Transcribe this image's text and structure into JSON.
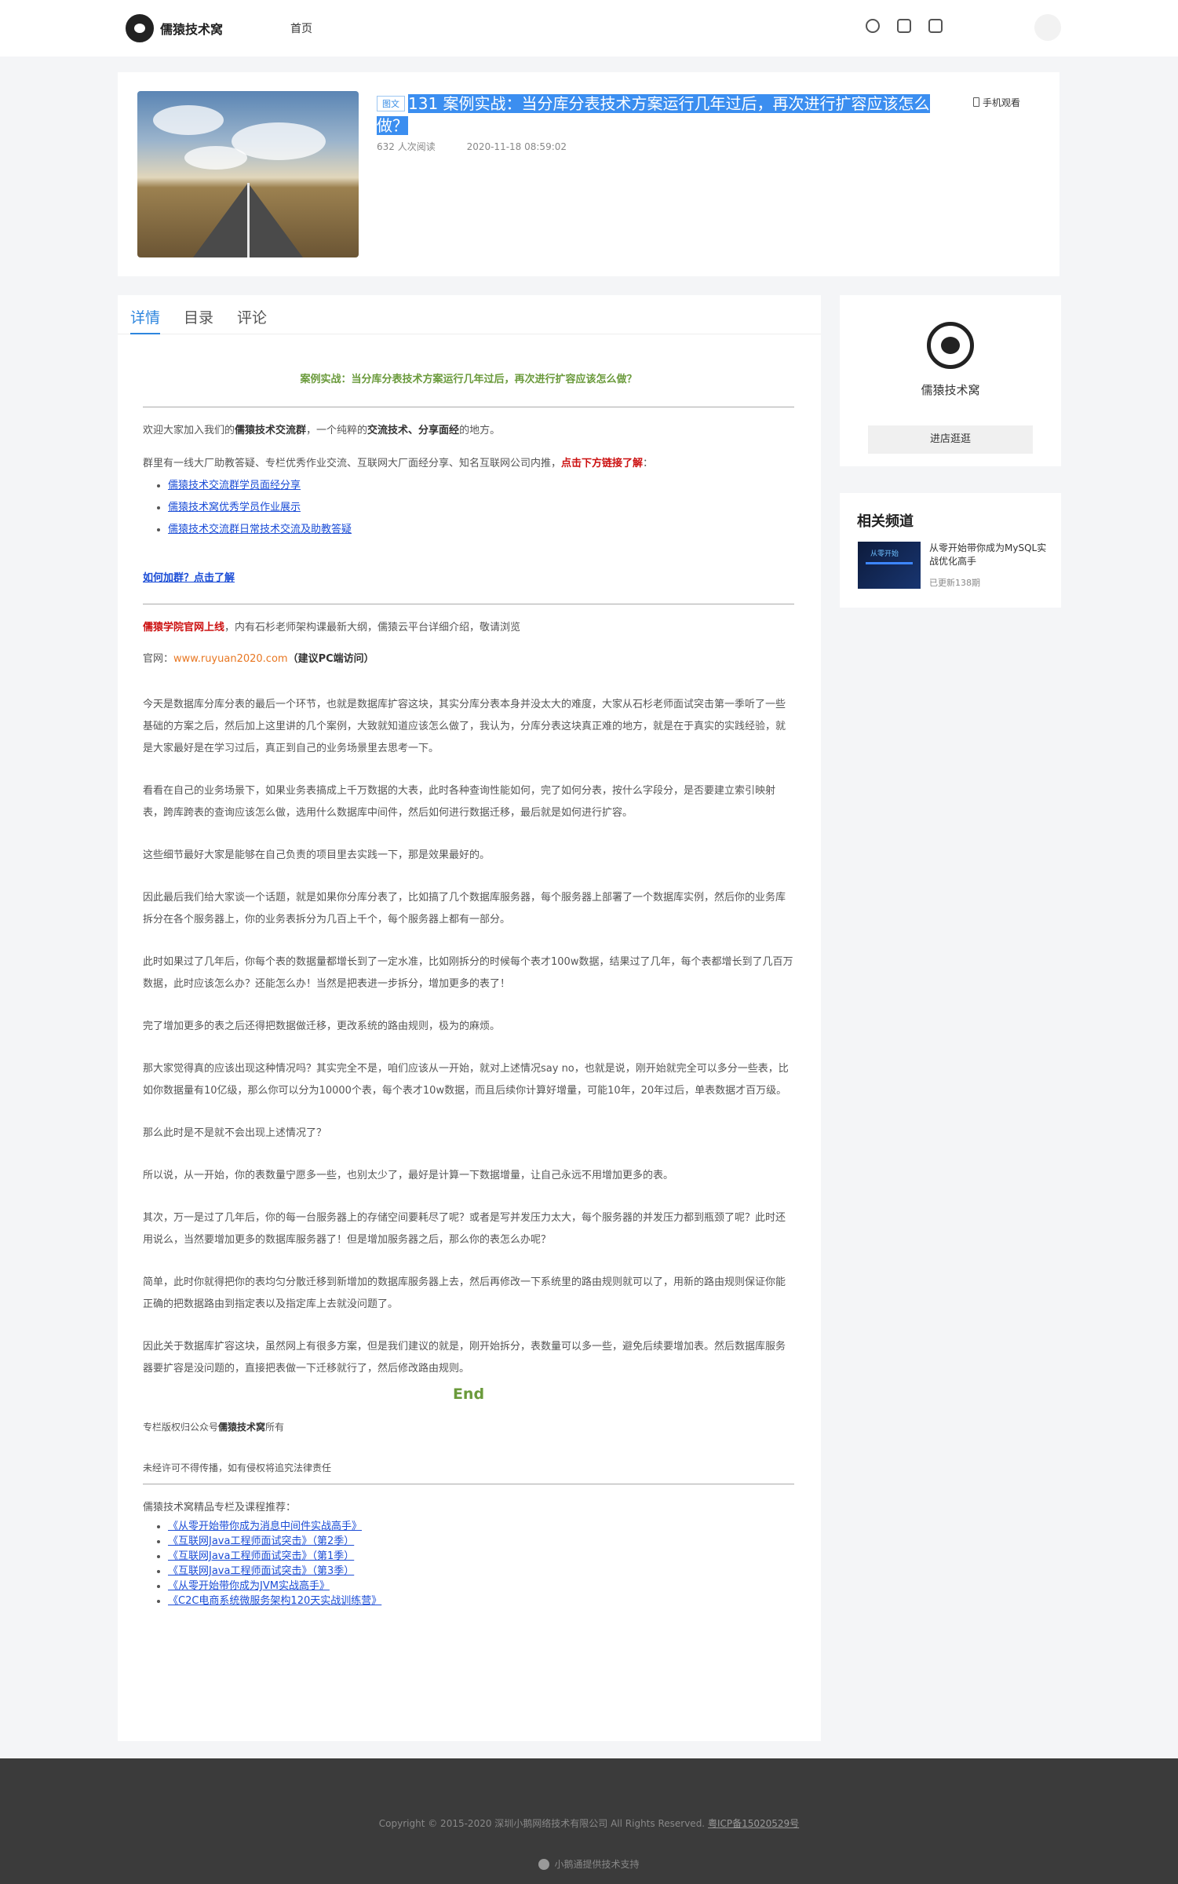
{
  "header": {
    "brand": "儒猿技术窝",
    "nav_home": "首页",
    "icons": [
      "search-icon",
      "document-icon",
      "cart-icon"
    ]
  },
  "course": {
    "type_badge": "图文",
    "title": "131 案例实战：当分库分表技术方案运行几年过后，再次进行扩容应该怎么做？",
    "views": "632 人次阅读",
    "date": "2020-11-18 08:59:02",
    "mobile_view": "手机观看"
  },
  "tabs": [
    "详情",
    "目录",
    "评论"
  ],
  "article": {
    "title": "案例实战：当分库分表技术方案运行几年过后，再次进行扩容应该怎么做？",
    "welcome_pre": "欢迎大家加入我们的",
    "welcome_group": "儒猿技术交流群",
    "welcome_mid": "，一个纯粹的",
    "welcome_bold2": "交流技术、分享面经",
    "welcome_post": "的地方。",
    "group_intro": "群里有一线大厂助教答疑、专栏优秀作业交流、互联网大厂面经分享、知名互联网公司内推，",
    "group_cta": "点击下方链接了解",
    "group_colon": "：",
    "links": [
      "儒猿技术交流群学员面经分享",
      "儒猿技术窝优秀学员作业展示",
      "儒猿技术交流群日常技术交流及助教答疑"
    ],
    "how_join": "如何加群？点击了解",
    "academy_red": "儒猿学院官网上线",
    "academy_text": "，内有石杉老师架构课最新大纲，儒猿云平台详细介绍，敬请浏览",
    "site_label": "官网：",
    "site_url": "www.ruyuan2020.com",
    "site_hint": "（建议PC端访问）",
    "paragraphs": [
      "今天是数据库分库分表的最后一个环节，也就是数据库扩容这块，其实分库分表本身并没太大的难度，大家从石杉老师面试突击第一季听了一些基础的方案之后，然后加上这里讲的几个案例，大致就知道应该怎么做了，我认为，分库分表这块真正难的地方，就是在于真实的实践经验，就是大家最好是在学习过后，真正到自己的业务场景里去思考一下。",
      "看看在自己的业务场景下，如果业务表搞成上千万数据的大表，此时各种查询性能如何，完了如何分表，按什么字段分，是否要建立索引映射表，跨库跨表的查询应该怎么做，选用什么数据库中间件，然后如何进行数据迁移，最后就是如何进行扩容。",
      "这些细节最好大家是能够在自己负责的项目里去实践一下，那是效果最好的。",
      "因此最后我们给大家谈一个话题，就是如果你分库分表了，比如搞了几个数据库服务器，每个服务器上部署了一个数据库实例，然后你的业务库拆分在各个服务器上，你的业务表拆分为几百上千个，每个服务器上都有一部分。",
      "此时如果过了几年后，你每个表的数据量都增长到了一定水准，比如刚拆分的时候每个表才100w数据，结果过了几年，每个表都增长到了几百万数据，此时应该怎么办？还能怎么办！当然是把表进一步拆分，增加更多的表了！",
      "完了增加更多的表之后还得把数据做迁移，更改系统的路由规则，极为的麻烦。",
      "那大家觉得真的应该出现这种情况吗？其实完全不是，咱们应该从一开始，就对上述情况say no，也就是说，刚开始就完全可以多分一些表，比如你数据量有10亿级，那么你可以分为10000个表，每个表才10w数据，而且后续你计算好增量，可能10年，20年过后，单表数据才百万级。",
      "那么此时是不是就不会出现上述情况了？",
      "所以说，从一开始，你的表数量宁愿多一些，也别太少了，最好是计算一下数据增量，让自己永远不用增加更多的表。",
      "其次，万一是过了几年后，你的每一台服务器上的存储空间要耗尽了呢？或者是写并发压力太大，每个服务器的并发压力都到瓶颈了呢？此时还用说么，当然要增加更多的数据库服务器了！但是增加服务器之后，那么你的表怎么办呢？",
      "简单，此时你就得把你的表均匀分散迁移到新增加的数据库服务器上去，然后再修改一下系统里的路由规则就可以了，用新的路由规则保证你能正确的把数据路由到指定表以及指定库上去就没问题了。",
      "因此关于数据库扩容这块，虽然网上有很多方案，但是我们建议的就是，刚开始拆分，表数量可以多一些，避免后续要增加表。然后数据库服务器要扩容是没问题的，直接把表做一下迁移就行了，然后修改路由规则。"
    ],
    "end": "End",
    "copyright_pre": "专栏版权归公众号",
    "copyright_bold": "儒猿技术窝",
    "copyright_post": "所有",
    "no_repost": "未经许可不得传播，如有侵权将追究法律责任",
    "rec_heading": "儒猿技术窝精品专栏及课程推荐：",
    "rec_items": [
      "《从零开始带你成为消息中间件实战高手》",
      "《互联网Java工程师面试突击》（第2季）",
      "《互联网Java工程师面试突击》（第1季）",
      "《互联网Java工程师面试突击》（第3季）",
      "《从零开始带你成为JVM实战高手》",
      "《C2C电商系统微服务架构120天实战训练营》"
    ]
  },
  "sidebar": {
    "store_name": "儒猿技术窝",
    "enter_button": "进店逛逛",
    "related_heading": "相关频道",
    "related_title": "从零开始带你成为MySQL实战优化高手",
    "related_meta": "已更新138期"
  },
  "footer": {
    "copyright": "Copyright © 2015-2020 深圳小鹅网络技术有限公司 All Rights Reserved.",
    "icp": "粤ICP备15020529号",
    "support": "小鹅通提供技术支持"
  }
}
